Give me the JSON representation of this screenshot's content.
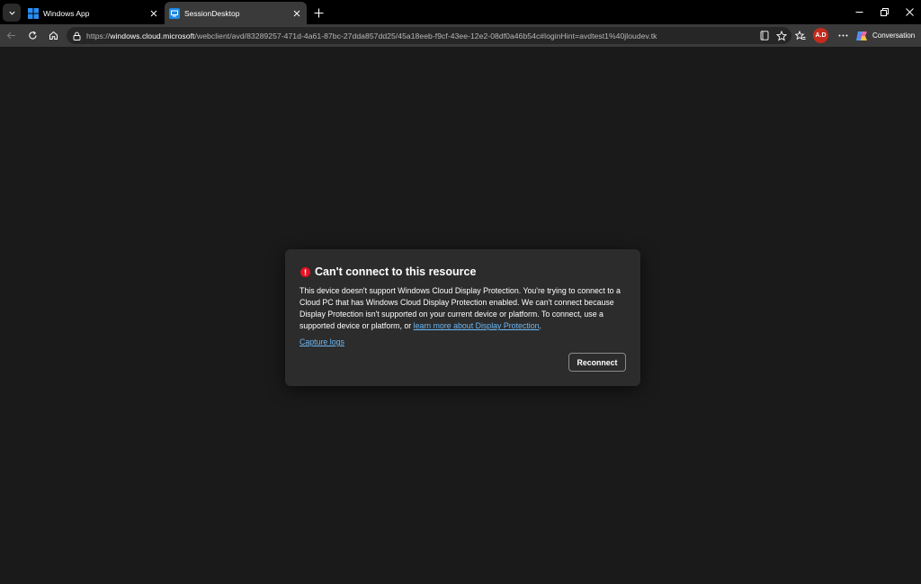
{
  "tabs": [
    {
      "title": "Windows App",
      "icon": "windows-logo-icon",
      "active": false
    },
    {
      "title": "SessionDesktop",
      "icon": "remote-desktop-icon",
      "active": true
    }
  ],
  "address_bar": {
    "url_prefix": "https://",
    "url_host": "windows.cloud.microsoft",
    "url_path": "/webclient/avd/83289257-471d-4a61-87bc-27dda857dd25/45a18eeb-f9cf-43ee-12e2-08df0a46b54c#loginHint=avdtest1%40jloudev.tk"
  },
  "profile_initials": "A.D",
  "conversation_label": "Conversation",
  "dialog": {
    "title": "Can't connect to this resource",
    "body": "This device doesn't support Windows Cloud Display Protection. You're trying to connect to a Cloud PC that has Windows Cloud Display Protection enabled. We can't connect because Display Protection isn't supported on your current device or platform. To connect, use a supported device or platform, or ",
    "body_link": "learn more about Display Protection",
    "body_end": ".",
    "capture_link": "Capture logs",
    "reconnect_label": "Reconnect"
  },
  "colors": {
    "error": "#e81123",
    "link": "#6cb8f5",
    "dialog_bg": "#2c2c2c",
    "page_bg": "#1a1a1a"
  }
}
